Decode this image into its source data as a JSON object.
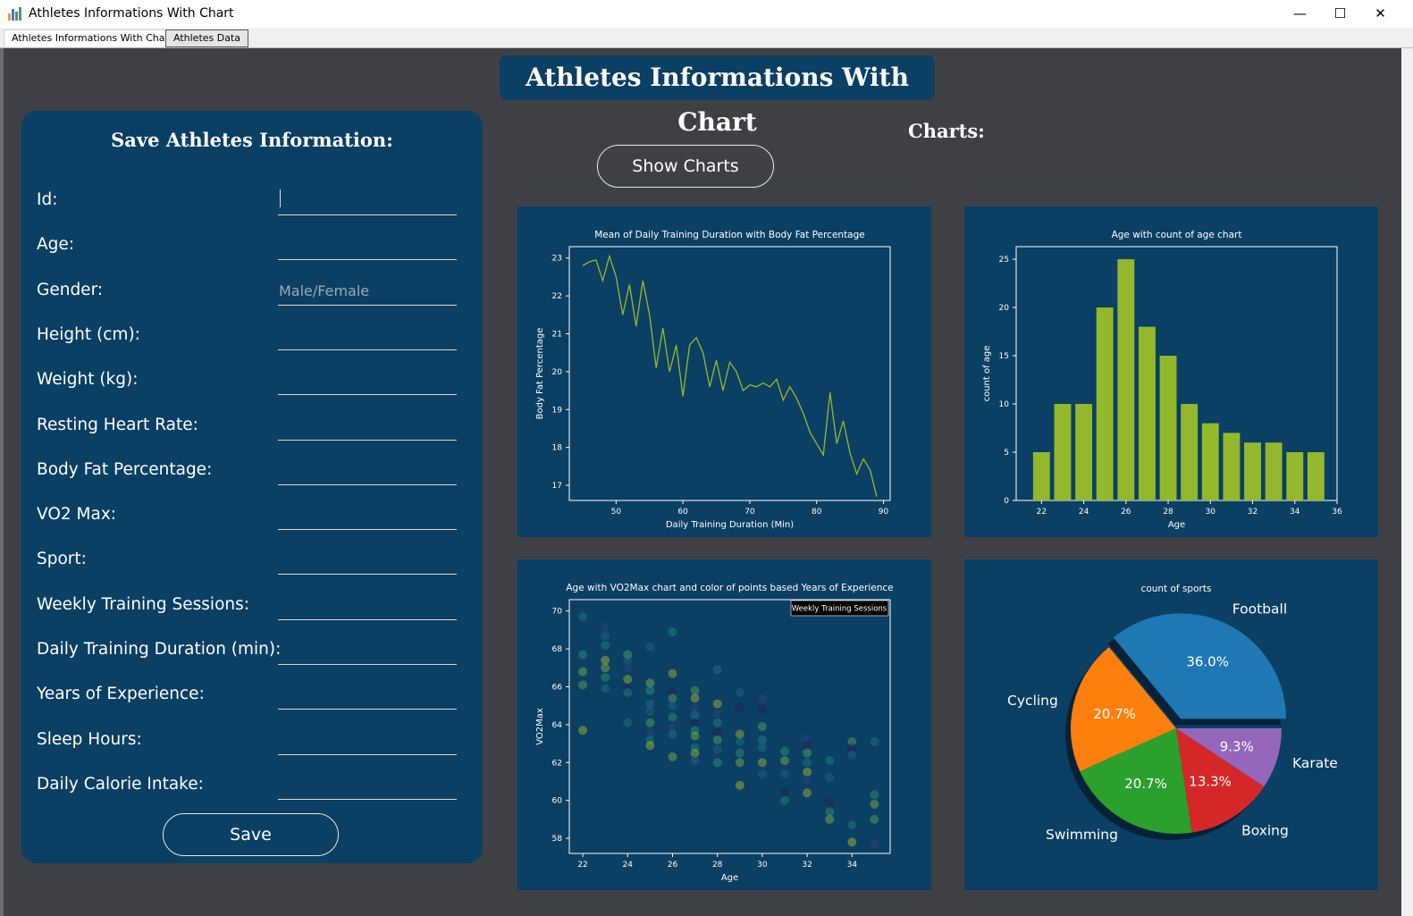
{
  "window": {
    "title": "Athletes Informations With Chart",
    "controls": {
      "minimize": "—",
      "maximize": "☐",
      "close": "✕"
    }
  },
  "tabs": [
    {
      "label": "Athletes Informations With Chart",
      "active": true
    },
    {
      "label": "Athletes Data",
      "active": false
    }
  ],
  "header": {
    "title": "Athletes Informations With Chart"
  },
  "form": {
    "heading": "Save Athletes Information:",
    "fields": [
      {
        "label": "Id:",
        "value": "",
        "placeholder": ""
      },
      {
        "label": "Age:",
        "value": "",
        "placeholder": ""
      },
      {
        "label": "Gender:",
        "value": "",
        "placeholder": "Male/Female"
      },
      {
        "label": "Height (cm):",
        "value": "",
        "placeholder": ""
      },
      {
        "label": "Weight (kg):",
        "value": "",
        "placeholder": ""
      },
      {
        "label": "Resting Heart Rate:",
        "value": "",
        "placeholder": ""
      },
      {
        "label": "Body Fat Percentage:",
        "value": "",
        "placeholder": ""
      },
      {
        "label": "VO2 Max:",
        "value": "",
        "placeholder": ""
      },
      {
        "label": "Sport:",
        "value": "",
        "placeholder": ""
      },
      {
        "label": "Weekly Training Sessions:",
        "value": "",
        "placeholder": ""
      },
      {
        "label": "Daily Training Duration (min):",
        "value": "",
        "placeholder": ""
      },
      {
        "label": "Years of Experience:",
        "value": "",
        "placeholder": ""
      },
      {
        "label": "Sleep Hours:",
        "value": "",
        "placeholder": ""
      },
      {
        "label": "Daily Calorie Intake:",
        "value": "",
        "placeholder": ""
      }
    ],
    "save_label": "Save"
  },
  "charts_section": {
    "label": "Charts:",
    "show_button": "Show Charts"
  },
  "colors": {
    "panel": "#0b3f63",
    "background": "#3f4046",
    "line": "#9ab92e",
    "bar": "#93b82c",
    "pie": [
      "#1f77b4",
      "#ff7f0e",
      "#2ca02c",
      "#d62728",
      "#9467bd"
    ]
  },
  "chart_data": [
    {
      "type": "line",
      "title": "Mean of Daily Training Duration with Body Fat Percentage",
      "xlabel": "Daily Training Duration (Min)",
      "ylabel": "Body Fat Percentage",
      "xlim": [
        43,
        91
      ],
      "ylim": [
        16.6,
        23.3
      ],
      "xticks": [
        50,
        60,
        70,
        80,
        90
      ],
      "yticks": [
        17,
        18,
        19,
        20,
        21,
        22,
        23
      ],
      "x": [
        45,
        46,
        47,
        48,
        49,
        50,
        51,
        52,
        53,
        54,
        55,
        56,
        57,
        58,
        59,
        60,
        61,
        62,
        63,
        64,
        65,
        66,
        67,
        68,
        69,
        70,
        71,
        72,
        73,
        74,
        75,
        76,
        77,
        78,
        79,
        80,
        81,
        82,
        83,
        84,
        85,
        86,
        87,
        88,
        89
      ],
      "y": [
        22.8,
        22.9,
        22.95,
        22.4,
        23.05,
        22.5,
        21.5,
        22.3,
        21.2,
        22.4,
        21.5,
        20.1,
        21.15,
        20.0,
        20.7,
        19.35,
        20.7,
        20.9,
        20.5,
        19.6,
        20.3,
        19.5,
        20.25,
        20.0,
        19.5,
        19.65,
        19.6,
        19.7,
        19.6,
        19.8,
        19.25,
        19.6,
        19.3,
        18.9,
        18.4,
        18.1,
        17.8,
        19.45,
        18.1,
        18.7,
        17.85,
        17.3,
        17.7,
        17.4,
        16.7
      ]
    },
    {
      "type": "bar",
      "title": "Age with count of age chart",
      "xlabel": "Age",
      "ylabel": "count of age",
      "xlim": [
        20.8,
        36
      ],
      "ylim": [
        0,
        26.3
      ],
      "xticks": [
        22,
        24,
        26,
        28,
        30,
        32,
        34,
        36
      ],
      "yticks": [
        0,
        5,
        10,
        15,
        20,
        25
      ],
      "categories": [
        22,
        23,
        24,
        25,
        26,
        27,
        28,
        29,
        30,
        31,
        32,
        33,
        34,
        35
      ],
      "values": [
        5,
        10,
        10,
        20,
        25,
        18,
        15,
        10,
        8,
        7,
        6,
        6,
        5,
        5
      ]
    },
    {
      "type": "scatter",
      "title": "Age with VO2Max chart and color of points based Years of Experience",
      "xlabel": "Age",
      "ylabel": "VO2Max",
      "legend": "Weekly Training Sessions",
      "legend_position": "top-right",
      "xlim": [
        21.4,
        35.7
      ],
      "ylim": [
        57.2,
        70.6
      ],
      "xticks": [
        22,
        24,
        26,
        28,
        30,
        32,
        34
      ],
      "yticks": [
        58,
        60,
        62,
        64,
        66,
        68,
        70
      ],
      "points": [
        [
          22,
          69.7,
          3
        ],
        [
          22,
          67.7,
          5
        ],
        [
          22,
          66.8,
          7
        ],
        [
          22,
          66.1,
          6
        ],
        [
          22,
          63.7,
          9
        ],
        [
          23,
          69.2,
          1
        ],
        [
          23,
          68.7,
          2
        ],
        [
          23,
          68.2,
          4
        ],
        [
          23,
          67.4,
          9
        ],
        [
          23,
          67.0,
          7
        ],
        [
          23,
          66.5,
          5
        ],
        [
          23,
          65.9,
          3
        ],
        [
          24,
          67.7,
          6
        ],
        [
          24,
          67.4,
          2
        ],
        [
          24,
          67.0,
          1
        ],
        [
          24,
          66.4,
          8
        ],
        [
          24,
          65.9,
          0
        ],
        [
          24,
          65.7,
          4
        ],
        [
          24,
          64.1,
          3
        ],
        [
          25,
          68.1,
          2
        ],
        [
          25,
          66.2,
          7
        ],
        [
          25,
          65.8,
          5
        ],
        [
          25,
          65.1,
          3
        ],
        [
          25,
          64.7,
          2
        ],
        [
          25,
          64.1,
          6
        ],
        [
          25,
          63.6,
          1
        ],
        [
          25,
          63.2,
          4
        ],
        [
          25,
          62.9,
          9
        ],
        [
          26,
          68.9,
          4
        ],
        [
          26,
          66.7,
          8
        ],
        [
          26,
          65.7,
          0
        ],
        [
          26,
          65.4,
          6
        ],
        [
          26,
          65.0,
          2
        ],
        [
          26,
          64.4,
          5
        ],
        [
          26,
          63.8,
          1
        ],
        [
          26,
          63.5,
          3
        ],
        [
          26,
          62.3,
          7
        ],
        [
          27,
          65.8,
          6
        ],
        [
          27,
          65.4,
          9
        ],
        [
          27,
          64.9,
          1
        ],
        [
          27,
          64.5,
          3
        ],
        [
          27,
          64.1,
          0
        ],
        [
          27,
          63.7,
          5
        ],
        [
          27,
          63.4,
          7
        ],
        [
          27,
          62.8,
          4
        ],
        [
          27,
          62.5,
          8
        ],
        [
          27,
          62.1,
          2
        ],
        [
          28,
          66.9,
          3
        ],
        [
          28,
          65.1,
          9
        ],
        [
          28,
          64.6,
          1
        ],
        [
          28,
          64.1,
          4
        ],
        [
          28,
          63.6,
          0
        ],
        [
          28,
          63.2,
          6
        ],
        [
          28,
          62.7,
          2
        ],
        [
          28,
          62.0,
          5
        ],
        [
          29,
          65.7,
          2
        ],
        [
          29,
          64.9,
          0
        ],
        [
          29,
          63.5,
          8
        ],
        [
          29,
          63.1,
          3
        ],
        [
          29,
          62.5,
          5
        ],
        [
          29,
          62.0,
          7
        ],
        [
          29,
          60.8,
          9
        ],
        [
          30,
          65.4,
          1
        ],
        [
          30,
          64.8,
          0
        ],
        [
          30,
          63.9,
          6
        ],
        [
          30,
          63.2,
          4
        ],
        [
          30,
          62.8,
          3
        ],
        [
          30,
          62.0,
          8
        ],
        [
          30,
          61.4,
          2
        ],
        [
          31,
          62.6,
          5
        ],
        [
          31,
          62.1,
          7
        ],
        [
          31,
          61.4,
          2
        ],
        [
          31,
          60.4,
          0
        ],
        [
          31,
          60.0,
          4
        ],
        [
          32,
          63.3,
          1
        ],
        [
          32,
          62.9,
          0
        ],
        [
          32,
          62.5,
          6
        ],
        [
          32,
          62.0,
          3
        ],
        [
          32,
          61.5,
          9
        ],
        [
          32,
          61.1,
          1
        ],
        [
          32,
          60.4,
          8
        ],
        [
          33,
          62.1,
          4
        ],
        [
          33,
          61.2,
          2
        ],
        [
          33,
          59.9,
          0
        ],
        [
          33,
          59.4,
          5
        ],
        [
          33,
          59.0,
          7
        ],
        [
          34,
          63.1,
          6
        ],
        [
          34,
          62.8,
          0
        ],
        [
          34,
          62.4,
          2
        ],
        [
          34,
          58.7,
          4
        ],
        [
          34,
          57.8,
          9
        ],
        [
          35,
          63.1,
          3
        ],
        [
          35,
          60.3,
          5
        ],
        [
          35,
          59.8,
          7
        ],
        [
          35,
          59.0,
          6
        ],
        [
          35,
          57.7,
          1
        ]
      ]
    },
    {
      "type": "pie",
      "title": "count of sports",
      "categories": [
        "Football",
        "Cycling",
        "Swimming",
        "Boxing",
        "Karate"
      ],
      "values": [
        36.0,
        20.7,
        20.7,
        13.3,
        9.3
      ],
      "labels_pct": [
        "36.0%",
        "20.7%",
        "20.7%",
        "13.3%",
        "9.3%"
      ],
      "explode": [
        0.1,
        0,
        0,
        0,
        0
      ],
      "shadow": true
    }
  ]
}
